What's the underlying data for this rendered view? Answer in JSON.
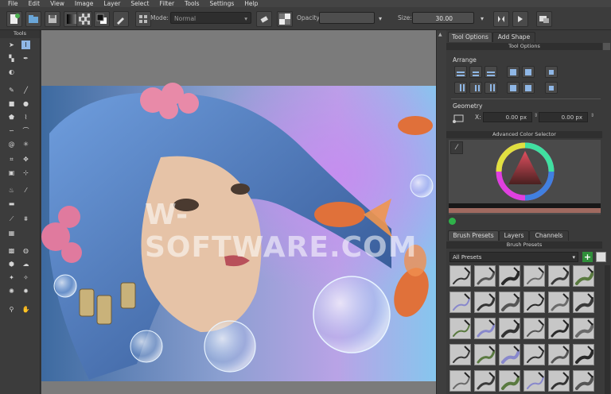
{
  "menu": [
    "File",
    "Edit",
    "View",
    "Image",
    "Layer",
    "Select",
    "Filter",
    "Tools",
    "Settings",
    "Help"
  ],
  "toolbar": {
    "mode_label": "Mode:",
    "mode_value": "Normal",
    "opacity_label": "Opacity:",
    "opacity_value": "",
    "size_label": "Size:",
    "size_value": "30.00"
  },
  "toolbox": {
    "title": "Tools"
  },
  "docker": {
    "tabs": [
      "Tool Options",
      "Add Shape"
    ],
    "tool_options_header": "Tool Options",
    "arrange_label": "Arrange",
    "geometry_label": "Geometry",
    "geom_x_label": "X:",
    "geom_x_value": "0.00 px",
    "geom_y_value": "0.00 px",
    "color_selector_header": "Advanced Color Selector",
    "bottom_tabs": [
      "Brush Presets",
      "Layers",
      "Channels"
    ],
    "brush_presets_header": "Brush Presets",
    "presets_filter": "All Presets"
  },
  "watermark": "W-SOFTWARE.COM",
  "colors": {
    "accent": "#8fb7e6",
    "ui_bg": "#3a3a3a",
    "canvas_bg": "#7b7b7b"
  }
}
